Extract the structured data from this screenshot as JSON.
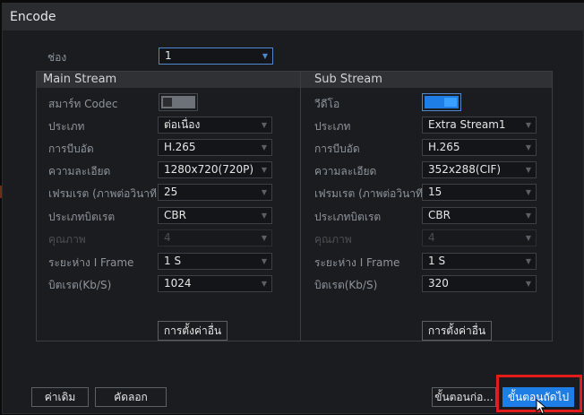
{
  "window": {
    "title": "Encode"
  },
  "channel": {
    "label": "ช่อง",
    "value": "1"
  },
  "main_stream": {
    "title": "Main Stream",
    "rows": [
      {
        "label": "สมาร์ท Codec",
        "type": "toggle",
        "state": "off"
      },
      {
        "label": "ประเภท",
        "value": "ต่อเนื่อง"
      },
      {
        "label": "การบีบอัด",
        "value": "H.265"
      },
      {
        "label": "ความละเอียด",
        "value": "1280x720(720P)"
      },
      {
        "label": "เฟรมเรต (ภาพต่อวินาที)",
        "value": "25"
      },
      {
        "label": "ประเภทบิตเรต",
        "value": "CBR"
      },
      {
        "label": "คุณภาพ",
        "value": "4",
        "disabled": true
      },
      {
        "label": "ระยะห่าง I Frame",
        "value": "1 S"
      },
      {
        "label": "บิตเรต(Kb/S)",
        "value": "1024"
      }
    ],
    "more_button": "การตั้งค่าอื่น"
  },
  "sub_stream": {
    "title": "Sub Stream",
    "rows": [
      {
        "label": "วีดีโอ",
        "type": "toggle",
        "state": "on"
      },
      {
        "label": "ประเภท",
        "value": "Extra Stream1"
      },
      {
        "label": "การบีบอัด",
        "value": "H.265"
      },
      {
        "label": "ความละเอียด",
        "value": "352x288(CIF)"
      },
      {
        "label": "เฟรมเรต (ภาพต่อวินาที)",
        "value": "15"
      },
      {
        "label": "ประเภทบิตเรต",
        "value": "CBR"
      },
      {
        "label": "คุณภาพ",
        "value": "4",
        "disabled": true
      },
      {
        "label": "ระยะห่าง I Frame",
        "value": "1 S"
      },
      {
        "label": "บิตเรต(Kb/S)",
        "value": "320"
      }
    ],
    "more_button": "การตั้งค่าอื่น"
  },
  "footer": {
    "default_button": "ค่าเดิม",
    "copy_button": "คัดลอก",
    "prev_button": "ขั้นตอนก่อ...",
    "next_button": "ขั้นตอนถัดไป"
  },
  "colors": {
    "accent": "#1f7de6",
    "highlight": "#e21b1b",
    "background": "#1b1c1f"
  }
}
